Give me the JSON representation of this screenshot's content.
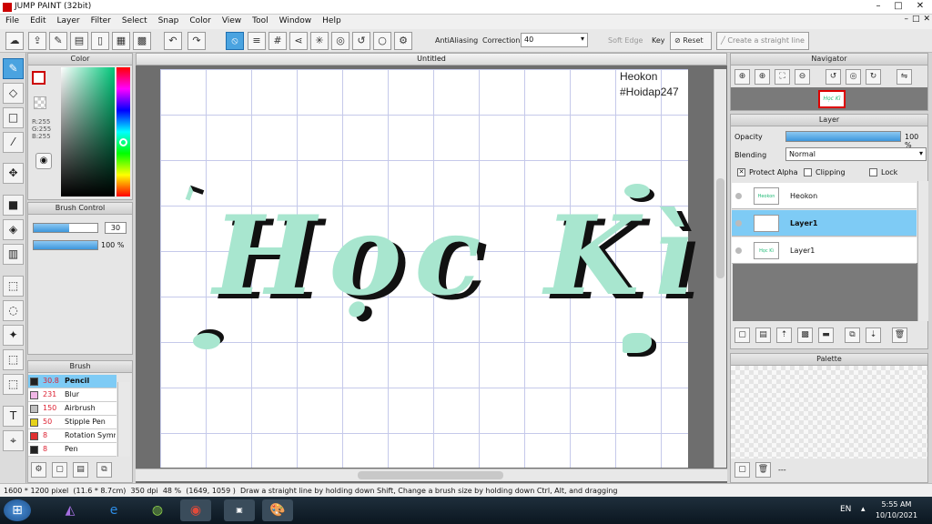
{
  "app": {
    "title": "JUMP PAINT (32bit)"
  },
  "menu": [
    "File",
    "Edit",
    "Layer",
    "Filter",
    "Select",
    "Snap",
    "Color",
    "View",
    "Tool",
    "Window",
    "Help"
  ],
  "window_controls": {
    "min": "–",
    "max": "□",
    "close": "✕"
  },
  "toolbar": {
    "antialiasing_label": "AntiAliasing",
    "correction_label": "Correction",
    "correction_value": "40",
    "soft_edge_label": "Soft Edge",
    "key_label": "Key",
    "reset_label": "Reset",
    "straight_line_label": "Create a straight line",
    "undo_icon": "↶",
    "redo_icon": "↷"
  },
  "color_panel": {
    "title": "Color",
    "r": "R:255",
    "g": "G:255",
    "b": "B:255"
  },
  "brush_control": {
    "title": "Brush Control",
    "size": "30",
    "opacity": "100 %",
    "size_fraction": 0.55,
    "opacity_fraction": 1.0
  },
  "brush_panel": {
    "title": "Brush",
    "items": [
      {
        "size": "30.8",
        "name": "Pencil",
        "color": "#222222",
        "selected": true
      },
      {
        "size": "231",
        "name": "Blur",
        "color": "#f0b6e6",
        "selected": false
      },
      {
        "size": "150",
        "name": "Airbrush",
        "color": "#bfbfbf",
        "selected": false
      },
      {
        "size": "50",
        "name": "Stipple Pen",
        "color": "#e6d21a",
        "selected": false
      },
      {
        "size": "8",
        "name": "Rotation Symmetry",
        "color": "#e03030",
        "selected": false
      },
      {
        "size": "8",
        "name": "Pen",
        "color": "#222222",
        "selected": false
      }
    ]
  },
  "canvas": {
    "tab_title": "Untitled",
    "watermark_line1": "Heokon",
    "watermark_line2": "#Hoidap247",
    "art_text": "Học Kì"
  },
  "navigator": {
    "title": "Navigator",
    "thumb_text": "Học Kì"
  },
  "layer_panel": {
    "title": "Layer",
    "opacity_label": "Opacity",
    "opacity_value": "100 %",
    "opacity_fraction": 1.0,
    "blending_label": "Blending",
    "blending_value": "Normal",
    "protect_alpha": "Protect Alpha",
    "clipping": "Clipping",
    "lock": "Lock",
    "layers": [
      {
        "name": "Heokon",
        "thumb": "Heokon #Hoidap247",
        "selected": false
      },
      {
        "name": "Layer1",
        "thumb": "",
        "selected": true
      },
      {
        "name": "Layer1",
        "thumb": "Học Kì",
        "selected": false
      }
    ]
  },
  "palette_panel": {
    "title": "Palette",
    "footer": "---"
  },
  "status": {
    "dims": "1600 * 1200 pixel",
    "cm": "(11.6 * 8.7cm)",
    "dpi": "350 dpi",
    "zoom": "48 %",
    "coords": "(1649, 1059 )",
    "hint": "Draw a straight line by holding down Shift, Change a brush size by holding down Ctrl, Alt, and dragging"
  },
  "taskbar": {
    "lang": "EN",
    "time": "5:55 AM",
    "date": "10/10/2021"
  }
}
